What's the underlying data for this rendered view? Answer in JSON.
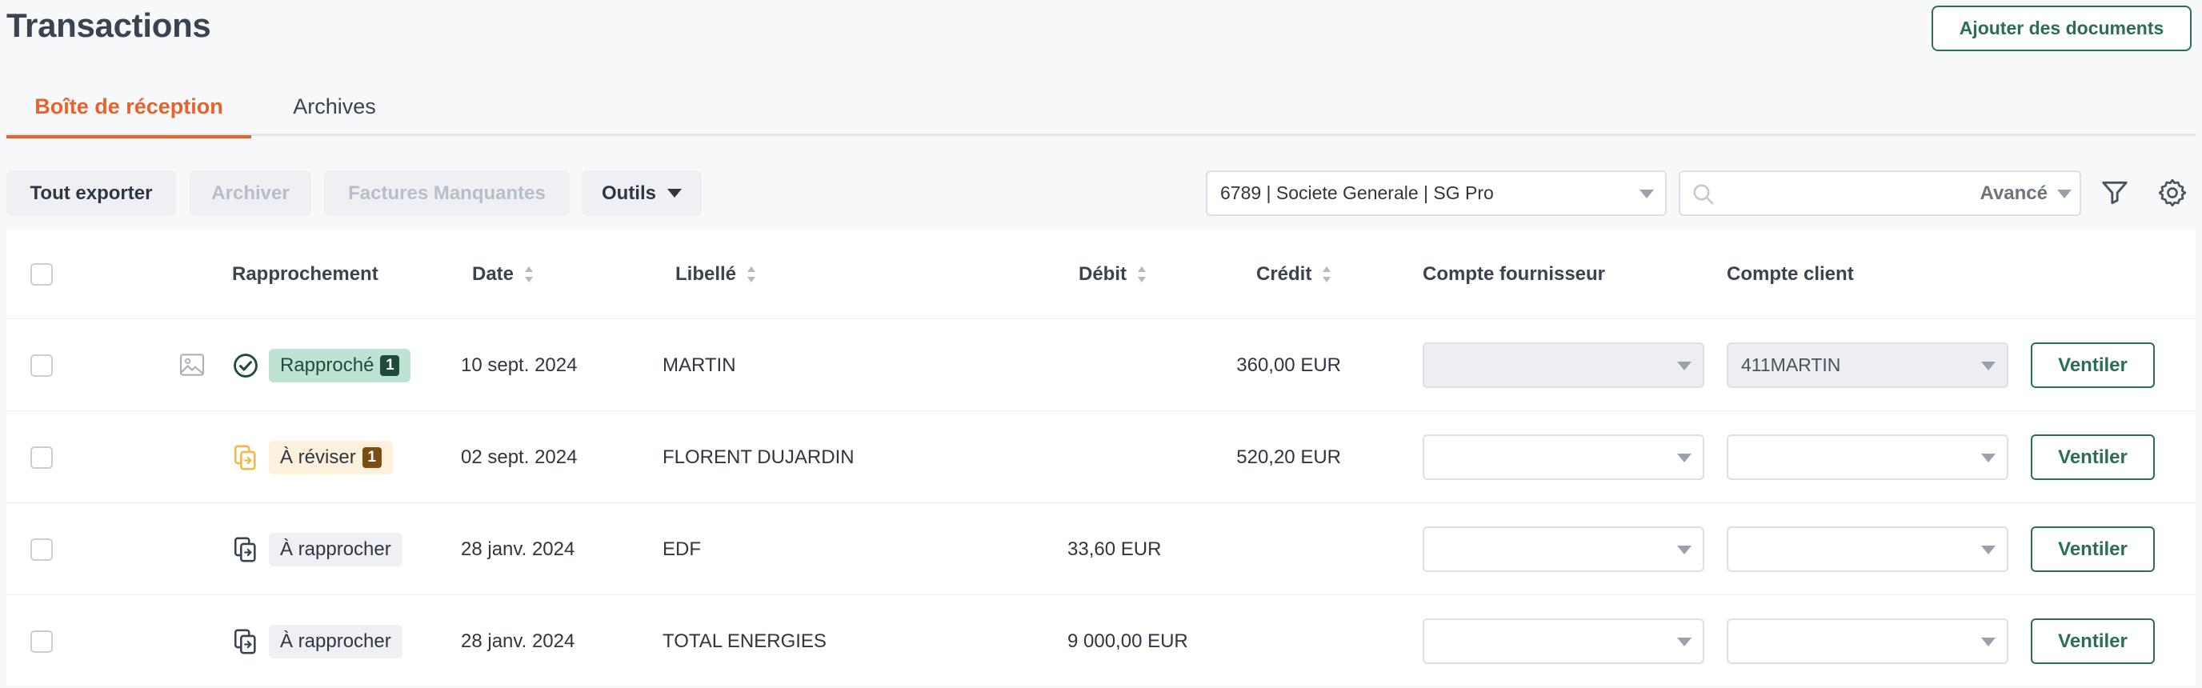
{
  "header": {
    "title": "Transactions",
    "add_documents_label": "Ajouter des documents"
  },
  "tabs": [
    {
      "label": "Boîte de réception",
      "active": true
    },
    {
      "label": "Archives",
      "active": false
    }
  ],
  "toolbar": {
    "export_all": "Tout exporter",
    "archive": "Archiver",
    "missing_invoices": "Factures Manquantes",
    "tools": "Outils",
    "account_selected": "6789 | Societe Generale | SG Pro",
    "search_value": "",
    "search_placeholder": "",
    "advanced": "Avancé"
  },
  "table": {
    "columns": {
      "reconciliation": "Rapprochement",
      "date": "Date",
      "label": "Libellé",
      "debit": "Débit",
      "credit": "Crédit",
      "supplier_account": "Compte fournisseur",
      "client_account": "Compte client"
    },
    "action_label": "Ventiler",
    "rows": [
      {
        "status": "Rapproché",
        "status_kind": "reconciled",
        "count": "1",
        "date": "10 sept. 2024",
        "label": "MARTIN",
        "debit": "",
        "credit": "360,00 EUR",
        "supplier_account": "",
        "client_account": "411MARTIN",
        "has_image": true
      },
      {
        "status": "À réviser",
        "status_kind": "review",
        "count": "1",
        "date": "02 sept. 2024",
        "label": "FLORENT DUJARDIN",
        "debit": "",
        "credit": "520,20 EUR",
        "supplier_account": "",
        "client_account": "",
        "has_image": false
      },
      {
        "status": "À rapprocher",
        "status_kind": "pending",
        "count": "",
        "date": "28 janv. 2024",
        "label": "EDF",
        "debit": "33,60 EUR",
        "credit": "",
        "supplier_account": "",
        "client_account": "",
        "has_image": false
      },
      {
        "status": "À rapprocher",
        "status_kind": "pending",
        "count": "",
        "date": "28 janv. 2024",
        "label": "TOTAL ENERGIES",
        "debit": "9 000,00 EUR",
        "credit": "",
        "supplier_account": "",
        "client_account": "",
        "has_image": false
      }
    ]
  },
  "colors": {
    "accent_orange": "#e8622c",
    "brand_green": "#2b6e55",
    "reconciled_bg": "#bfe3d3",
    "review_bg": "#fdf0dc",
    "review_icon": "#f2b64a"
  },
  "icons": [
    "search-icon",
    "filter-icon",
    "gear-icon",
    "image-icon",
    "check-circle-icon",
    "documents-icon",
    "sort-icon",
    "chevron-down-icon"
  ]
}
